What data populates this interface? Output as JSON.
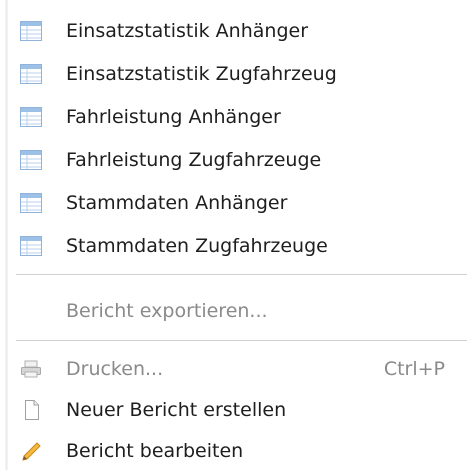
{
  "menu": {
    "items": [
      {
        "label": "Einsatzstatistik Anhänger",
        "icon": "report-table-icon"
      },
      {
        "label": "Einsatzstatistik Zugfahrzeug",
        "icon": "report-table-icon"
      },
      {
        "label": "Fahrleistung Anhänger",
        "icon": "report-table-icon"
      },
      {
        "label": "Fahrleistung Zugfahrzeuge",
        "icon": "report-table-icon"
      },
      {
        "label": "Stammdaten Anhänger",
        "icon": "report-table-icon"
      },
      {
        "label": "Stammdaten Zugfahrzeuge",
        "icon": "report-table-icon"
      }
    ],
    "export": {
      "label": "Bericht exportieren...",
      "enabled": false
    },
    "print": {
      "label": "Drucken...",
      "shortcut": "Ctrl+P",
      "icon": "printer-icon",
      "enabled": false
    },
    "new_report": {
      "label": "Neuer Bericht erstellen",
      "icon": "new-document-icon"
    },
    "edit_report": {
      "label": "Bericht bearbeiten",
      "icon": "pencil-icon"
    }
  },
  "colors": {
    "text": "#1e1e1e",
    "disabled_text": "#8a8a8a",
    "separator": "#d0d0d0",
    "icon_blue": "#9cc0e6"
  }
}
